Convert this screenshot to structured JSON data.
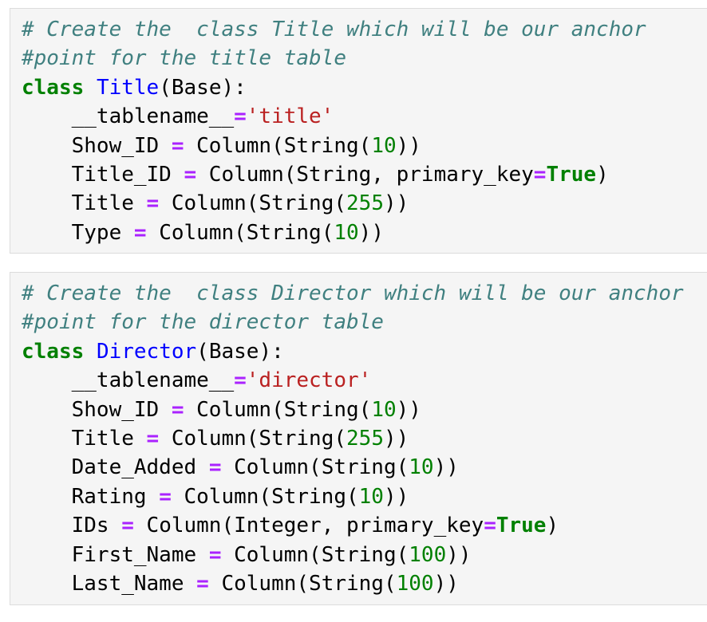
{
  "cells": [
    {
      "lines": [
        [
          {
            "cls": "c",
            "t": "# Create the  class Title which will be our anchor"
          }
        ],
        [
          {
            "cls": "c",
            "t": "#point for the title table"
          }
        ],
        [
          {
            "cls": "k",
            "t": "class"
          },
          {
            "cls": "",
            "t": " "
          },
          {
            "cls": "nc",
            "t": "Title"
          },
          {
            "cls": "",
            "t": "(Base):"
          }
        ],
        [
          {
            "cls": "",
            "t": "    __tablename__"
          },
          {
            "cls": "o",
            "t": "="
          },
          {
            "cls": "s",
            "t": "'title'"
          }
        ],
        [
          {
            "cls": "",
            "t": "    Show_ID "
          },
          {
            "cls": "o",
            "t": "="
          },
          {
            "cls": "",
            "t": " Column(String("
          },
          {
            "cls": "m",
            "t": "10"
          },
          {
            "cls": "",
            "t": "))"
          }
        ],
        [
          {
            "cls": "",
            "t": "    Title_ID "
          },
          {
            "cls": "o",
            "t": "="
          },
          {
            "cls": "",
            "t": " Column(String, primary_key"
          },
          {
            "cls": "o",
            "t": "="
          },
          {
            "cls": "k",
            "t": "True"
          },
          {
            "cls": "",
            "t": ")"
          }
        ],
        [
          {
            "cls": "",
            "t": "    Title "
          },
          {
            "cls": "o",
            "t": "="
          },
          {
            "cls": "",
            "t": " Column(String("
          },
          {
            "cls": "m",
            "t": "255"
          },
          {
            "cls": "",
            "t": "))"
          }
        ],
        [
          {
            "cls": "",
            "t": "    Type "
          },
          {
            "cls": "o",
            "t": "="
          },
          {
            "cls": "",
            "t": " Column(String("
          },
          {
            "cls": "m",
            "t": "10"
          },
          {
            "cls": "",
            "t": "))"
          }
        ]
      ]
    },
    {
      "lines": [
        [
          {
            "cls": "c",
            "t": "# Create the  class Director which will be our anchor"
          }
        ],
        [
          {
            "cls": "c",
            "t": "#point for the director table"
          }
        ],
        [
          {
            "cls": "k",
            "t": "class"
          },
          {
            "cls": "",
            "t": " "
          },
          {
            "cls": "nc",
            "t": "Director"
          },
          {
            "cls": "",
            "t": "(Base):"
          }
        ],
        [
          {
            "cls": "",
            "t": "    __tablename__"
          },
          {
            "cls": "o",
            "t": "="
          },
          {
            "cls": "s",
            "t": "'director'"
          }
        ],
        [
          {
            "cls": "",
            "t": "    Show_ID "
          },
          {
            "cls": "o",
            "t": "="
          },
          {
            "cls": "",
            "t": " Column(String("
          },
          {
            "cls": "m",
            "t": "10"
          },
          {
            "cls": "",
            "t": "))"
          }
        ],
        [
          {
            "cls": "",
            "t": "    Title "
          },
          {
            "cls": "o",
            "t": "="
          },
          {
            "cls": "",
            "t": " Column(String("
          },
          {
            "cls": "m",
            "t": "255"
          },
          {
            "cls": "",
            "t": "))"
          }
        ],
        [
          {
            "cls": "",
            "t": "    Date_Added "
          },
          {
            "cls": "o",
            "t": "="
          },
          {
            "cls": "",
            "t": " Column(String("
          },
          {
            "cls": "m",
            "t": "10"
          },
          {
            "cls": "",
            "t": "))"
          }
        ],
        [
          {
            "cls": "",
            "t": "    Rating "
          },
          {
            "cls": "o",
            "t": "="
          },
          {
            "cls": "",
            "t": " Column(String("
          },
          {
            "cls": "m",
            "t": "10"
          },
          {
            "cls": "",
            "t": "))"
          }
        ],
        [
          {
            "cls": "",
            "t": "    IDs "
          },
          {
            "cls": "o",
            "t": "="
          },
          {
            "cls": "",
            "t": " Column(Integer, primary_key"
          },
          {
            "cls": "o",
            "t": "="
          },
          {
            "cls": "k",
            "t": "True"
          },
          {
            "cls": "",
            "t": ")"
          }
        ],
        [
          {
            "cls": "",
            "t": "    First_Name "
          },
          {
            "cls": "o",
            "t": "="
          },
          {
            "cls": "",
            "t": " Column(String("
          },
          {
            "cls": "m",
            "t": "100"
          },
          {
            "cls": "",
            "t": "))"
          }
        ],
        [
          {
            "cls": "",
            "t": "    Last_Name "
          },
          {
            "cls": "o",
            "t": "="
          },
          {
            "cls": "",
            "t": " Column(String("
          },
          {
            "cls": "m",
            "t": "100"
          },
          {
            "cls": "",
            "t": "))"
          }
        ]
      ]
    }
  ],
  "colors": {
    "cell_background": "#f5f5f5",
    "comment": "#408080",
    "keyword": "#008000",
    "class_name": "#0000ff",
    "string": "#ba2121",
    "operator": "#aa22ff",
    "number": "#008000"
  }
}
